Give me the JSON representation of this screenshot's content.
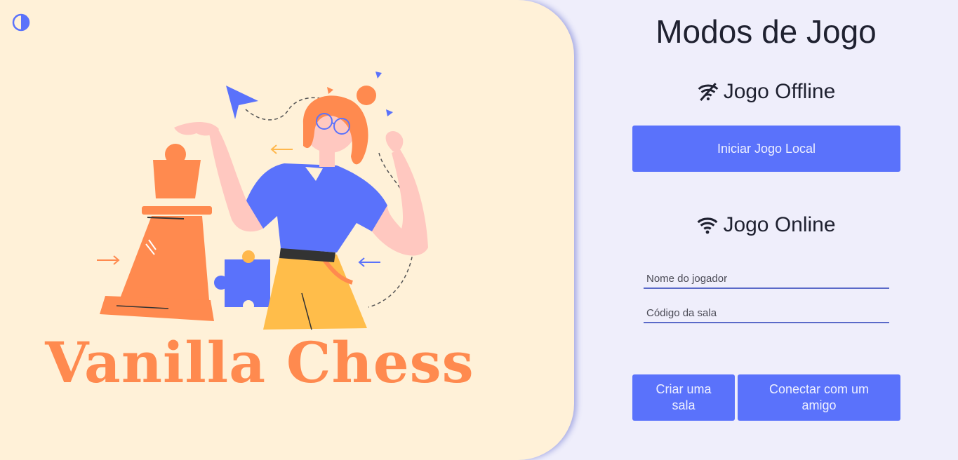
{
  "hero": {
    "title": "Vanilla Chess",
    "theme_toggle_icon": "half-circle-contrast-icon"
  },
  "panel": {
    "title": "Modos de Jogo",
    "offline": {
      "title": "Jogo Offline",
      "icon": "wifi-off-icon",
      "button": "Iniciar Jogo Local"
    },
    "online": {
      "title": "Jogo Online",
      "icon": "wifi-icon",
      "player_placeholder": "Nome do jogador",
      "room_placeholder": "Código da sala",
      "create_button": "Criar uma sala",
      "connect_button": "Conectar com um amigo"
    }
  },
  "colors": {
    "accent": "#5a72fb",
    "hero_bg": "#fff1d8",
    "panel_bg": "#efeefb",
    "brand_orange": "#ff8a4f"
  }
}
